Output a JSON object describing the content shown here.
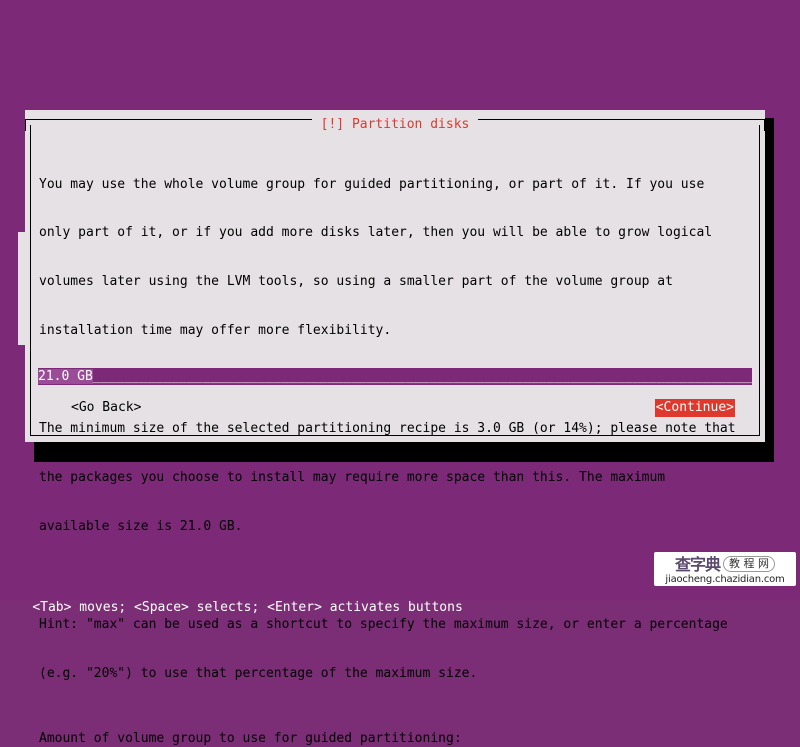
{
  "colors": {
    "desktop_background": "#7c2a78",
    "dialog_background": "#e6e1e5",
    "title_accent": "#df382c",
    "button_highlight": "#df382c",
    "input_background": "#7c2a78",
    "input_selection": "#9b4c97",
    "text": "#000000",
    "status_text": "#ffffff"
  },
  "dialog": {
    "title": "[!] Partition disks",
    "paragraphs": [
      [
        "You may use the whole volume group for guided partitioning, or part of it. If you use",
        "only part of it, or if you add more disks later, then you will be able to grow logical",
        "volumes later using the LVM tools, so using a smaller part of the volume group at",
        "installation time may offer more flexibility."
      ],
      [
        "The minimum size of the selected partitioning recipe is 3.0 GB (or 14%); please note that",
        "the packages you choose to install may require more space than this. The maximum",
        "available size is 21.0 GB."
      ],
      [
        "Hint: \"max\" can be used as a shortcut to specify the maximum size, or enter a percentage",
        "(e.g. \"20%\") to use that percentage of the maximum size."
      ]
    ],
    "prompt_label": "Amount of volume group to use for guided partitioning:",
    "input": {
      "value": "21.0 GB",
      "fill": "_________________________________________________________________________________________________________",
      "placeholder": "21.0 GB"
    },
    "buttons": {
      "go_back": "<Go Back>",
      "continue": "<Continue>"
    }
  },
  "status_bar": {
    "text": "<Tab> moves; <Space> selects; <Enter> activates buttons"
  },
  "watermark": {
    "brand_cn": "查字典",
    "badge_cn": "教 程 网",
    "url": "jiaocheng.chazidian.com"
  }
}
